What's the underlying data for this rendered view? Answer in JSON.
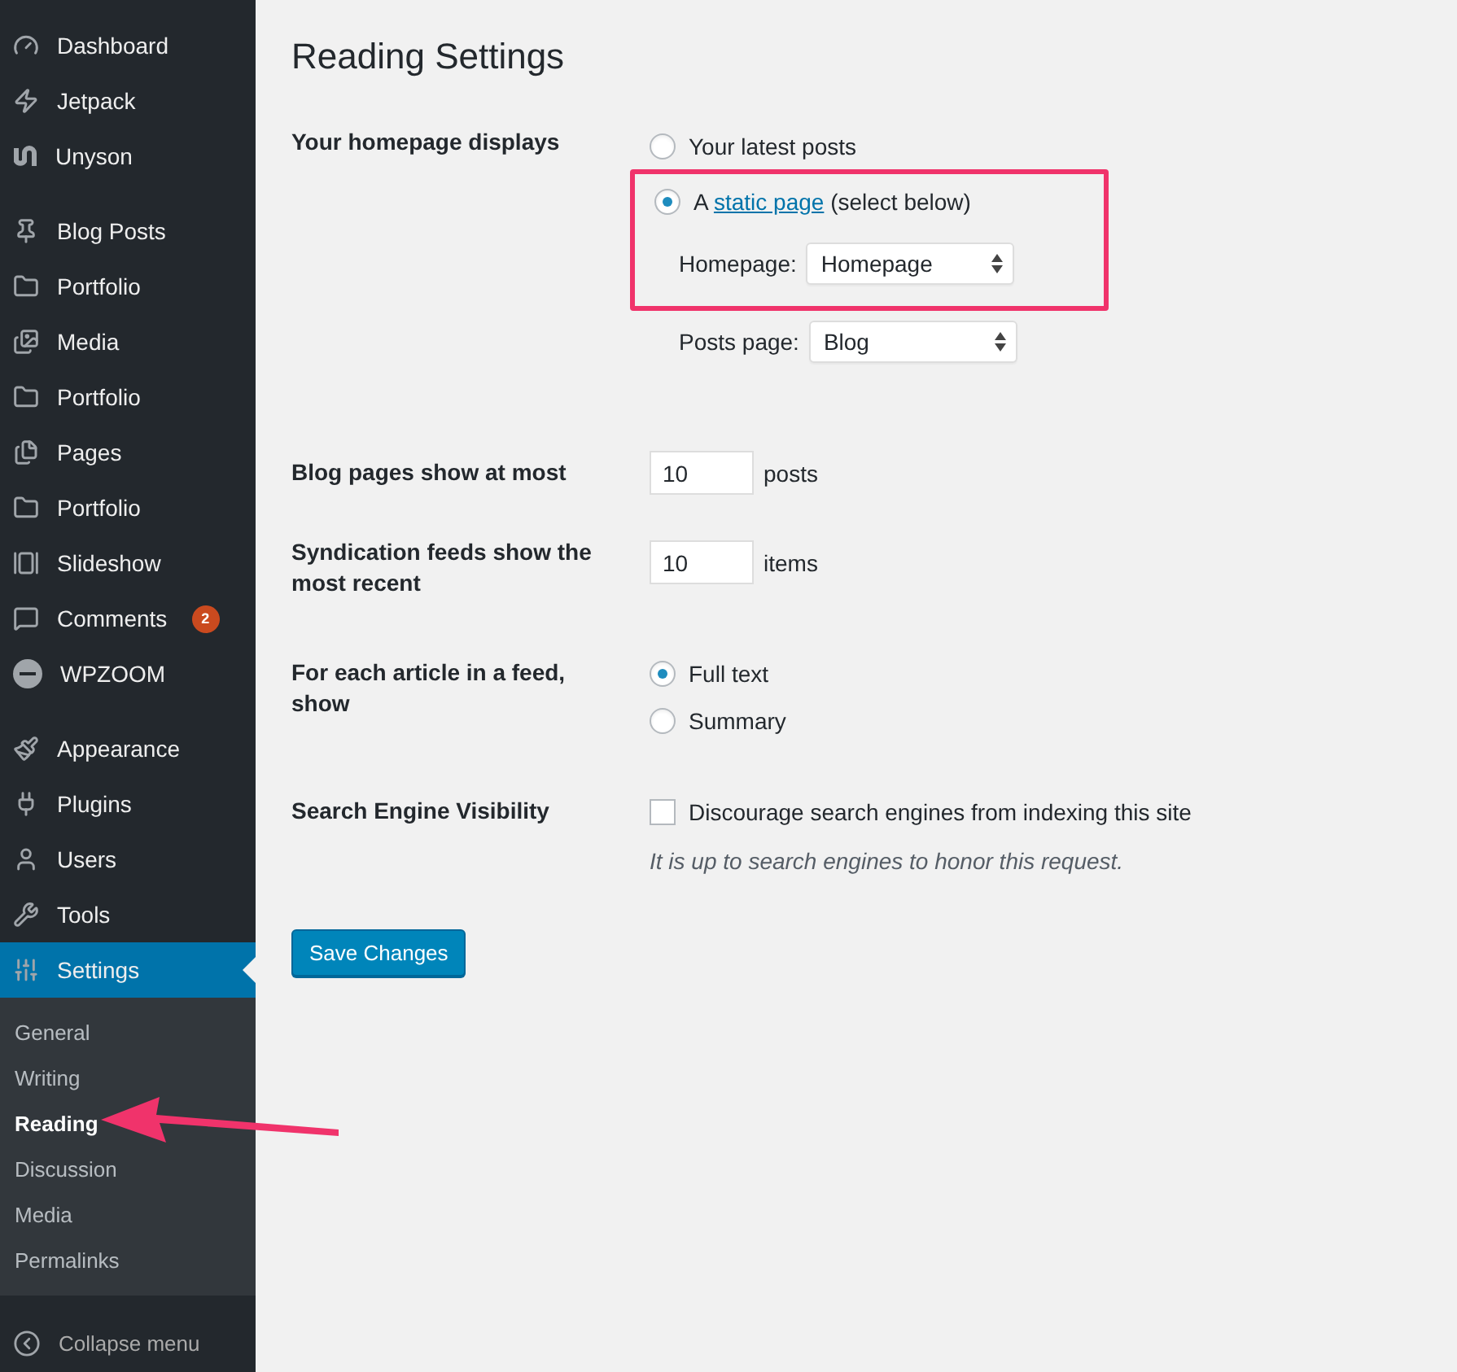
{
  "sidebar": {
    "groups": [
      [
        {
          "label": "Dashboard",
          "selected": false
        },
        {
          "label": "Jetpack",
          "selected": false
        },
        {
          "label": "Unyson",
          "selected": false
        }
      ],
      [
        {
          "label": "Blog Posts",
          "selected": false
        },
        {
          "label": "Portfolio",
          "selected": false
        },
        {
          "label": "Media",
          "selected": false
        },
        {
          "label": "Portfolio",
          "selected": false
        },
        {
          "label": "Pages",
          "selected": false
        },
        {
          "label": "Portfolio",
          "selected": false
        },
        {
          "label": "Slideshow",
          "selected": false
        },
        {
          "label": "Comments",
          "selected": false,
          "badge": "2"
        },
        {
          "label": "WPZOOM",
          "selected": false
        }
      ],
      [
        {
          "label": "Appearance",
          "selected": false
        },
        {
          "label": "Plugins",
          "selected": false
        },
        {
          "label": "Users",
          "selected": false
        },
        {
          "label": "Tools",
          "selected": false
        },
        {
          "label": "Settings",
          "selected": true,
          "submenu": [
            {
              "label": "General",
              "selected": false
            },
            {
              "label": "Writing",
              "selected": false
            },
            {
              "label": "Reading",
              "selected": true
            },
            {
              "label": "Discussion",
              "selected": false
            },
            {
              "label": "Media",
              "selected": false
            },
            {
              "label": "Permalinks",
              "selected": false
            }
          ]
        }
      ]
    ],
    "collapse": "Collapse menu"
  },
  "title": "Reading Settings",
  "homepage_displays": {
    "label": "Your homepage displays",
    "options": [
      {
        "prefix": "Your latest posts",
        "selected": false
      },
      {
        "prefix": "A",
        "link": "static page",
        "suffix": "(select below)",
        "selected": true
      }
    ],
    "selects": [
      {
        "label": "Homepage:",
        "value": "Homepage"
      },
      {
        "label": "Posts page:",
        "value": "Blog"
      }
    ]
  },
  "blog_pages": {
    "label": "Blog pages show at most",
    "value": "10",
    "unit": "posts"
  },
  "syndication": {
    "label": "Syndication feeds show the most recent",
    "value": "10",
    "unit": "items"
  },
  "feed_article": {
    "label": "For each article in a feed, show",
    "options": [
      {
        "label": "Full text",
        "selected": true
      },
      {
        "label": "Summary",
        "selected": false
      }
    ]
  },
  "search_visibility": {
    "label": "Search Engine Visibility",
    "checkbox_label": "Discourage search engines from indexing this site",
    "checked": false,
    "hint": "It is up to search engines to honor this request."
  },
  "save_button": "Save Changes"
}
